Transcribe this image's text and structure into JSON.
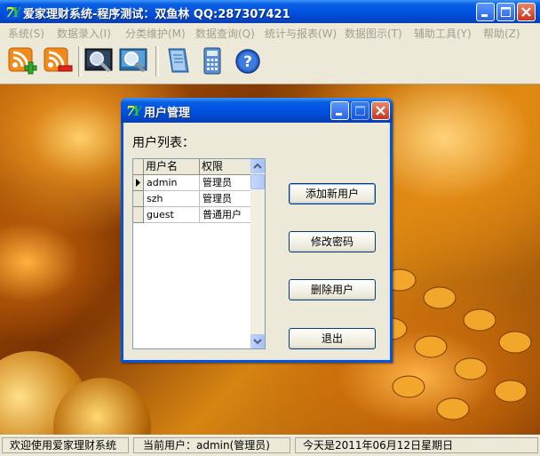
{
  "window": {
    "title": "爱家理财系统-程序测试：双鱼林 QQ:287307421"
  },
  "menu": [
    "系统(S)",
    "数据录入(I)",
    "分类维护(M)",
    "数据查询(Q)",
    "统计与报表(W)",
    "数据图示(T)",
    "辅助工具(Y)",
    "帮助(Z)"
  ],
  "toolbar": {
    "buttons": [
      "rss-add-icon",
      "rss-remove-icon",
      "search-icon",
      "find-icon",
      "notebook-icon",
      "calculator-icon",
      "help-icon"
    ]
  },
  "dialog": {
    "title": "用户管理",
    "list_label": "用户列表：",
    "columns": [
      "用户名",
      "权限"
    ],
    "rows": [
      {
        "username": "admin",
        "role": "管理员"
      },
      {
        "username": "szh",
        "role": "管理员"
      },
      {
        "username": "guest",
        "role": "普通用户"
      }
    ],
    "buttons": {
      "add": "添加新用户",
      "change_password": "修改密码",
      "delete": "删除用户",
      "exit": "退出"
    }
  },
  "status": {
    "welcome": "欢迎使用爱家理财系统",
    "current_user": "当前用户：admin(管理员)",
    "date": "今天是2011年06月12日星期日"
  },
  "colors": {
    "titlebar": "#0054e3",
    "face": "#ece9d8"
  }
}
